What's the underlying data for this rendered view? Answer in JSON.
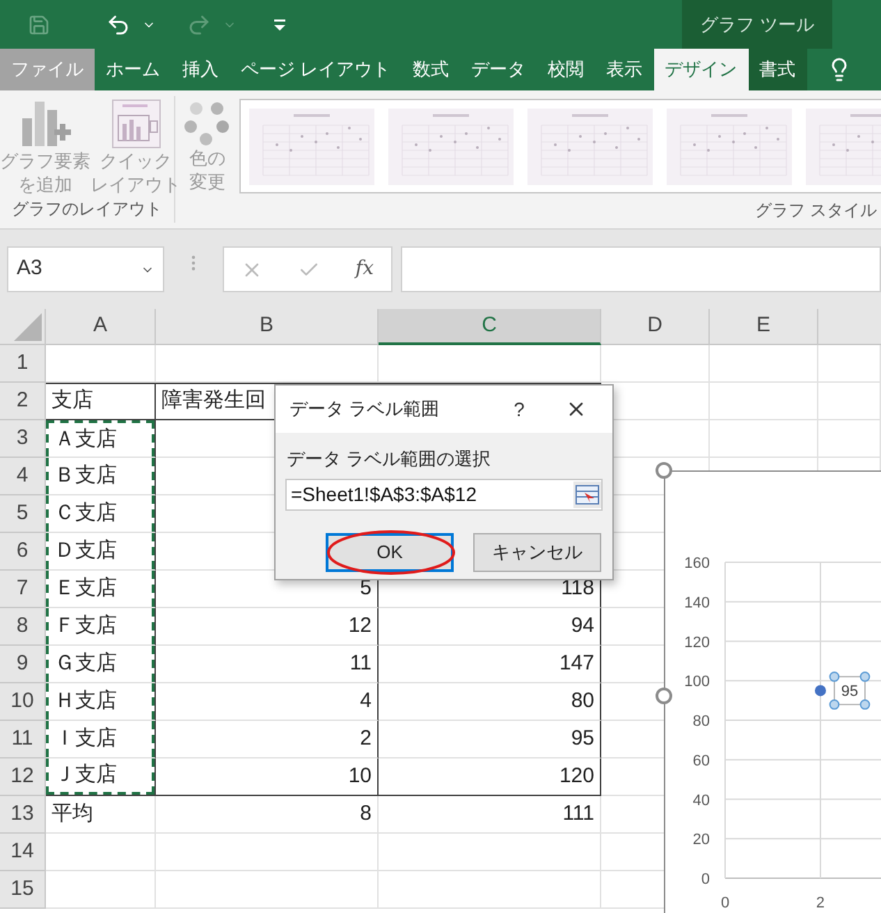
{
  "title_bar": {
    "context_label": "グラフ ツール"
  },
  "ribbon_tabs": [
    {
      "label": "ファイル",
      "kind": "file",
      "selected": false
    },
    {
      "label": "ホーム",
      "kind": "main",
      "selected": false
    },
    {
      "label": "挿入",
      "kind": "main",
      "selected": false
    },
    {
      "label": "ページ レイアウト",
      "kind": "main",
      "selected": false
    },
    {
      "label": "数式",
      "kind": "main",
      "selected": false
    },
    {
      "label": "データ",
      "kind": "main",
      "selected": false
    },
    {
      "label": "校閲",
      "kind": "main",
      "selected": false
    },
    {
      "label": "表示",
      "kind": "main",
      "selected": false
    },
    {
      "label": "デザイン",
      "kind": "context",
      "selected": true
    },
    {
      "label": "書式",
      "kind": "context",
      "selected": false
    }
  ],
  "ribbon": {
    "layout_group": {
      "label": "グラフのレイアウト",
      "buttons": [
        {
          "kind": "add_element",
          "lines": [
            "グラフ要素",
            "を追加"
          ]
        },
        {
          "kind": "quick_layout",
          "lines": [
            "クイック",
            "レイアウト"
          ]
        }
      ]
    },
    "color_button": {
      "lines": [
        "色の",
        "変更"
      ]
    },
    "style_group": {
      "label": "グラフ スタイル",
      "thumbnails": [
        {
          "kind": "thumbnail"
        },
        {
          "kind": "thumbnail"
        },
        {
          "kind": "thumbnail"
        },
        {
          "kind": "thumbnail"
        },
        {
          "kind": "thumbnail"
        }
      ]
    }
  },
  "formula_bar": {
    "name_box": "A3",
    "function_label": "fx"
  },
  "columns": [
    {
      "label": "A",
      "selected": false
    },
    {
      "label": "B",
      "selected": false
    },
    {
      "label": "C",
      "selected": true
    },
    {
      "label": "D",
      "selected": false
    },
    {
      "label": "E",
      "selected": false
    }
  ],
  "rows": [
    {
      "header": "1",
      "kind": "plain",
      "cells": {}
    },
    {
      "header": "2",
      "kind": "table_head",
      "cells": {
        "a": {
          "text": "支店",
          "kind": "text",
          "marked": false
        },
        "b": {
          "text": "障害発生回",
          "kind": "text"
        }
      }
    },
    {
      "header": "3",
      "kind": "table_body",
      "cells": {
        "a": {
          "text": "Ａ支店",
          "kind": "text",
          "marked": true
        }
      }
    },
    {
      "header": "4",
      "kind": "table_body",
      "cells": {
        "a": {
          "text": "Ｂ支店",
          "kind": "text",
          "marked": true
        }
      }
    },
    {
      "header": "5",
      "kind": "table_body",
      "cells": {
        "a": {
          "text": "Ｃ支店",
          "kind": "text",
          "marked": true
        }
      }
    },
    {
      "header": "6",
      "kind": "table_body",
      "cells": {
        "a": {
          "text": "Ｄ支店",
          "kind": "text",
          "marked": true
        }
      }
    },
    {
      "header": "7",
      "kind": "table_body",
      "cells": {
        "a": {
          "text": "Ｅ支店",
          "kind": "text",
          "marked": true
        },
        "b": {
          "text": "5",
          "kind": "number"
        },
        "c": {
          "text": "118",
          "kind": "number"
        }
      }
    },
    {
      "header": "8",
      "kind": "table_body",
      "cells": {
        "a": {
          "text": "Ｆ支店",
          "kind": "text",
          "marked": true
        },
        "b": {
          "text": "12",
          "kind": "number"
        },
        "c": {
          "text": "94",
          "kind": "number"
        }
      }
    },
    {
      "header": "9",
      "kind": "table_body",
      "cells": {
        "a": {
          "text": "Ｇ支店",
          "kind": "text",
          "marked": true
        },
        "b": {
          "text": "11",
          "kind": "number"
        },
        "c": {
          "text": "147",
          "kind": "number"
        }
      }
    },
    {
      "header": "10",
      "kind": "table_body",
      "cells": {
        "a": {
          "text": "Ｈ支店",
          "kind": "text",
          "marked": true
        },
        "b": {
          "text": "4",
          "kind": "number"
        },
        "c": {
          "text": "80",
          "kind": "number"
        }
      }
    },
    {
      "header": "11",
      "kind": "table_body",
      "cells": {
        "a": {
          "text": "Ｉ支店",
          "kind": "text",
          "marked": true
        },
        "b": {
          "text": "2",
          "kind": "number"
        },
        "c": {
          "text": "95",
          "kind": "number"
        }
      }
    },
    {
      "header": "12",
      "kind": "table_end",
      "cells": {
        "a": {
          "text": "Ｊ支店",
          "kind": "text",
          "marked": true
        },
        "b": {
          "text": "10",
          "kind": "number"
        },
        "c": {
          "text": "120",
          "kind": "number"
        }
      }
    },
    {
      "header": "13",
      "kind": "plain",
      "cells": {
        "a": {
          "text": "平均",
          "kind": "text",
          "marked": false
        },
        "b": {
          "text": "8",
          "kind": "number"
        },
        "c": {
          "text": "111",
          "kind": "number"
        }
      }
    },
    {
      "header": "14",
      "kind": "plain",
      "cells": {}
    },
    {
      "header": "15",
      "kind": "plain",
      "cells": {}
    }
  ],
  "dialog": {
    "title": "データ ラベル範囲",
    "help": "?",
    "prompt": "データ ラベル範囲の選択",
    "range_value": "=Sheet1!$A$3:$A$12",
    "buttons": [
      {
        "label": "OK",
        "selected": true,
        "circled": true
      },
      {
        "label": "キャンセル",
        "selected": false,
        "circled": false
      }
    ]
  },
  "chart": {
    "chart_data": {
      "type": "scatter",
      "x": [
        2
      ],
      "series": [
        {
          "color": "#4472c4",
          "values": [
            95
          ]
        }
      ],
      "xlim": [
        0,
        3.3
      ],
      "ylim": [
        0,
        160
      ],
      "grid": true,
      "xticks": [
        0,
        2
      ],
      "yticks": [
        0,
        20,
        40,
        60,
        80,
        100,
        120,
        140,
        160
      ],
      "data_labels": true
    }
  }
}
